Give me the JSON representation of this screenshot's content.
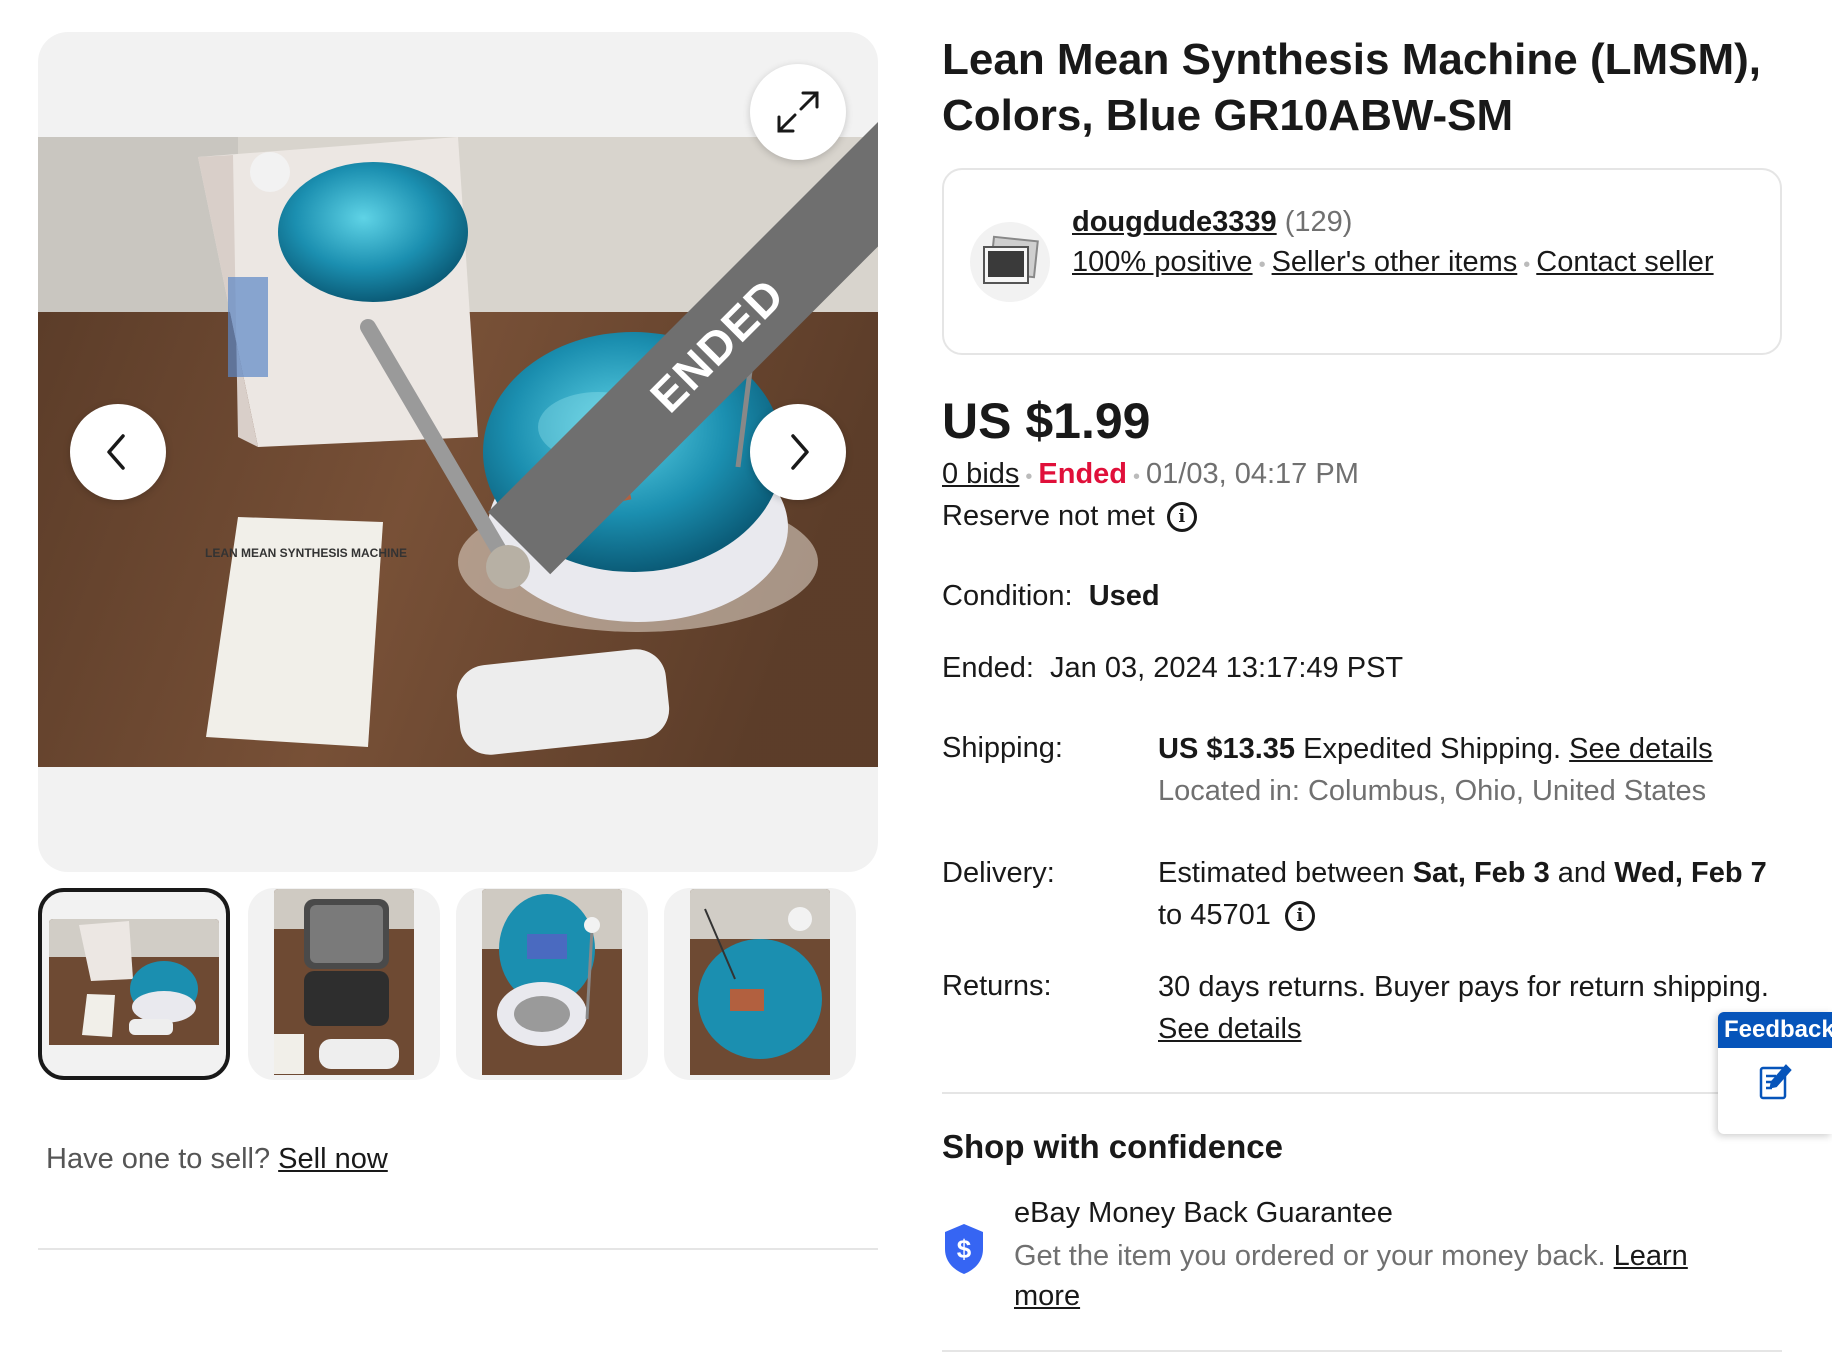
{
  "listing": {
    "title": "Lean Mean Synthesis Machine (LMSM), Colors, Blue GR10ABW-SM",
    "ended_ribbon": "ENDED"
  },
  "gallery": {
    "photo_texts": [
      "LEAN MEAN SYNTHESIS MACHINE",
      "LEAN MEAN SYNTHESIS MACHINE",
      "LEAN MEAN SYNTHESIS MACHINE"
    ],
    "thumbnail_count": 4,
    "selected_thumbnail": 1
  },
  "seller": {
    "name": "dougdude3339",
    "feedback_count": "(129)",
    "positive": "100% positive",
    "other_items": "Seller's other items",
    "contact": "Contact seller"
  },
  "price": {
    "amount": "US $1.99",
    "bids": "0 bids",
    "status": "Ended",
    "ended_short": "01/03, 04:17 PM",
    "reserve": "Reserve not met"
  },
  "details": {
    "condition_label": "Condition:",
    "condition_value": "Used",
    "ended_label": "Ended:",
    "ended_value": "Jan 03, 2024 13:17:49 PST",
    "shipping_label": "Shipping:",
    "shipping_cost": "US $13.35",
    "shipping_method": "Expedited Shipping.",
    "shipping_link": "See details",
    "located": "Located in: Columbus, Ohio, United States",
    "delivery_label": "Delivery:",
    "delivery_prefix": "Estimated between",
    "delivery_start": "Sat, Feb 3",
    "delivery_and": "and",
    "delivery_end": "Wed, Feb 7",
    "delivery_zip": "to 45701",
    "returns_label": "Returns:",
    "returns_text": "30 days returns. Buyer pays for return shipping.",
    "returns_link": "See details"
  },
  "sell": {
    "prompt": "Have one to sell?",
    "link": "Sell now"
  },
  "confidence": {
    "heading": "Shop with confidence",
    "guarantee_title": "eBay Money Back Guarantee",
    "guarantee_text": "Get the item you ordered or your money back.",
    "learn_more": "Learn more"
  },
  "feedback_tab": {
    "label": "Feedback"
  },
  "icons": {
    "expand": "expand-icon",
    "prev": "chevron-left-icon",
    "next": "chevron-right-icon",
    "info": "info-icon",
    "shield": "shield-dollar-icon",
    "feedback": "feedback-edit-icon"
  },
  "colors": {
    "ended_red": "#e0103a",
    "ribbon_gray": "#6f6f6f",
    "feedback_blue": "#0654ba",
    "shield_blue": "#3665f3"
  }
}
